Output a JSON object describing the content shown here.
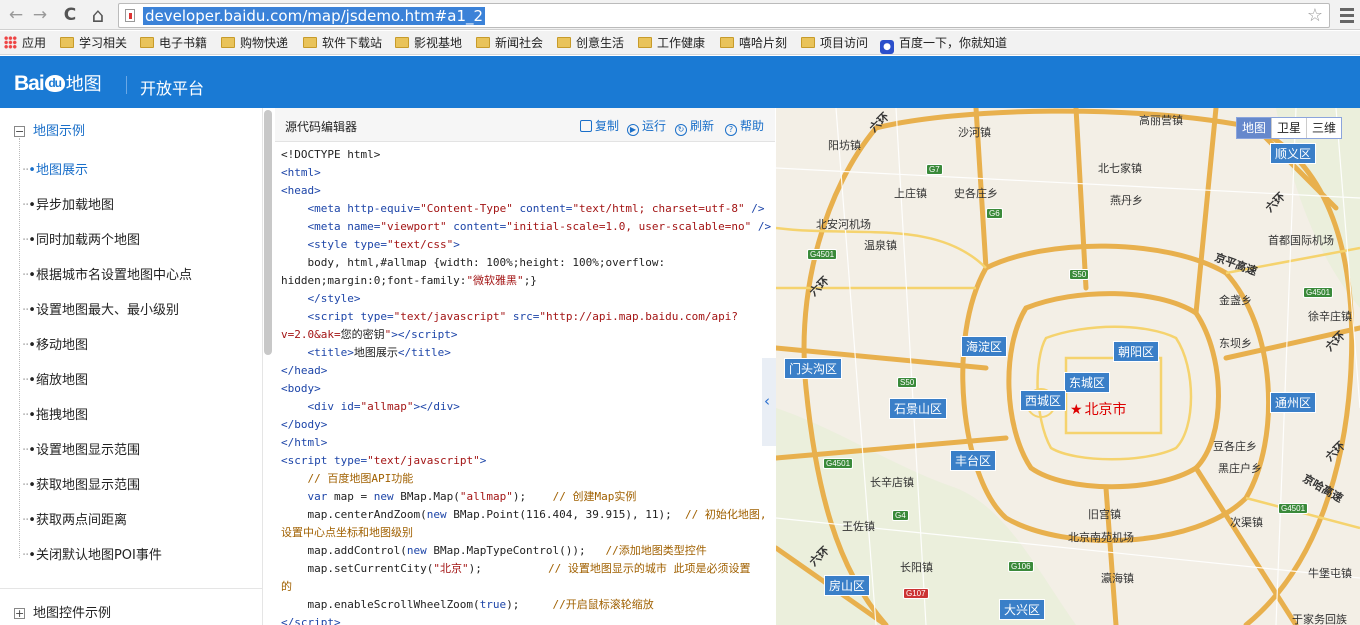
{
  "browser": {
    "url": "developer.baidu.com/map/jsdemo.htm#a1_2",
    "back": "←",
    "forward": "→",
    "reload": "C",
    "home": "⌂",
    "star": "☆"
  },
  "bookmarks": [
    "应用",
    "学习相关",
    "电子书籍",
    "购物快递",
    "软件下载站",
    "影视基地",
    "新闻社会",
    "创意生活",
    "工作健康",
    "嘻哈片刻",
    "项目访问",
    "百度一下，你就知道"
  ],
  "header": {
    "logo_a": "Bai",
    "logo_b": "du",
    "logo_c": "地图",
    "platform": "开放平台"
  },
  "sidebar": {
    "section1": "地图示例",
    "section1_toggle": "−",
    "items": [
      "地图展示",
      "异步加载地图",
      "同时加载两个地图",
      "根据城市名设置地图中心点",
      "设置地图最大、最小级别",
      "移动地图",
      "缩放地图",
      "拖拽地图",
      "设置地图显示范围",
      "获取地图显示范围",
      "获取两点间距离",
      "关闭默认地图POI事件"
    ],
    "section2": "地图控件示例",
    "section2_toggle": "+"
  },
  "editor": {
    "title": "源代码编辑器",
    "copy": "复制",
    "run": "运行",
    "refresh": "刷新",
    "help": "帮助",
    "expand": "‹"
  },
  "map": {
    "types": [
      "地图",
      "卫星",
      "三维"
    ],
    "center": "北京市",
    "center_mark": "★",
    "districts": [
      "顺义区",
      "海淀区",
      "朝阳区",
      "门头沟区",
      "东城区",
      "西城区",
      "石景山区",
      "通州区",
      "丰台区",
      "房山区",
      "大兴区"
    ],
    "places": [
      "高丽营镇",
      "沙河镇",
      "阳坊镇",
      "北七家镇",
      "上庄镇",
      "史各庄乡",
      "燕丹乡",
      "北安河机场",
      "温泉镇",
      "首都国际机场",
      "金盏乡",
      "徐辛庄镇",
      "东坝乡",
      "豆各庄乡",
      "黑庄户乡",
      "长辛店镇",
      "次渠镇",
      "王佐镇",
      "旧宫镇",
      "北京南苑机场",
      "牛堡屯镇",
      "长阳镇",
      "瀛海镇",
      "于家务回族"
    ],
    "highways": [
      "G7",
      "G6",
      "G4501",
      "S50",
      "G4501",
      "S50",
      "G4501",
      "G4501",
      "G4",
      "G106",
      "G107"
    ],
    "rings": [
      "六环",
      "六环",
      "六环",
      "六环",
      "六环",
      "六环"
    ],
    "ring_road_labels": [
      "京平高速",
      "京哈高速"
    ]
  }
}
